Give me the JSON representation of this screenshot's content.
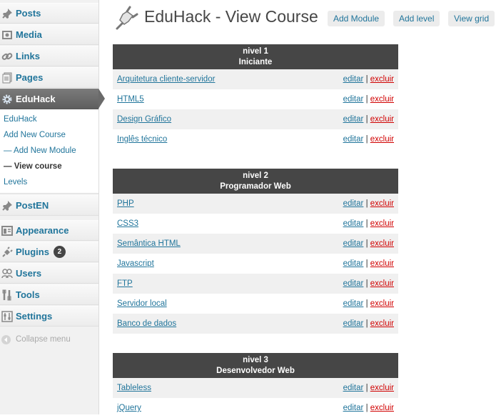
{
  "sidebar": {
    "menu": [
      {
        "key": "posts",
        "label": "Posts",
        "icon": "pin-icon"
      },
      {
        "key": "media",
        "label": "Media",
        "icon": "media-icon"
      },
      {
        "key": "links",
        "label": "Links",
        "icon": "link-icon"
      },
      {
        "key": "pages",
        "label": "Pages",
        "icon": "pages-icon"
      },
      {
        "key": "eduhack",
        "label": "EduHack",
        "icon": "gear-icon"
      },
      {
        "key": "posten",
        "label": "PostEN",
        "icon": "pin-icon"
      },
      {
        "key": "appearance",
        "label": "Appearance",
        "icon": "appearance-icon"
      },
      {
        "key": "plugins",
        "label": "Plugins",
        "icon": "plugin-icon",
        "badge": "2"
      },
      {
        "key": "users",
        "label": "Users",
        "icon": "users-icon"
      },
      {
        "key": "tools",
        "label": "Tools",
        "icon": "tools-icon"
      },
      {
        "key": "settings",
        "label": "Settings",
        "icon": "settings-icon"
      }
    ],
    "submenu": [
      "EduHack",
      "Add New Course",
      "— Add New Module",
      "— View course",
      "Levels"
    ],
    "collapse_label": "Collapse menu"
  },
  "header": {
    "title": "EduHack - View Course",
    "buttons": [
      "Add Module",
      "Add level",
      "View grid"
    ]
  },
  "actions": {
    "edit": "editar",
    "separator": "|",
    "delete": "excluir"
  },
  "levels": [
    {
      "label": "nivel 1",
      "name": "Iniciante",
      "courses": [
        "Arquitetura cliente-servidor",
        "HTML5",
        "Design Gráfico",
        "Inglês técnico"
      ]
    },
    {
      "label": "nivel 2",
      "name": "Programador Web",
      "courses": [
        "PHP",
        "CSS3",
        "Semântica HTML",
        "Javascript",
        "FTP",
        "Servidor local",
        "Banco de dados"
      ]
    },
    {
      "label": "nivel 3",
      "name": "Desenvolvedor Web",
      "courses": [
        "Tableless",
        "jQuery"
      ]
    }
  ],
  "colors": {
    "link": "#21759b",
    "delete": "#d00000",
    "header_bg": "#464646"
  }
}
